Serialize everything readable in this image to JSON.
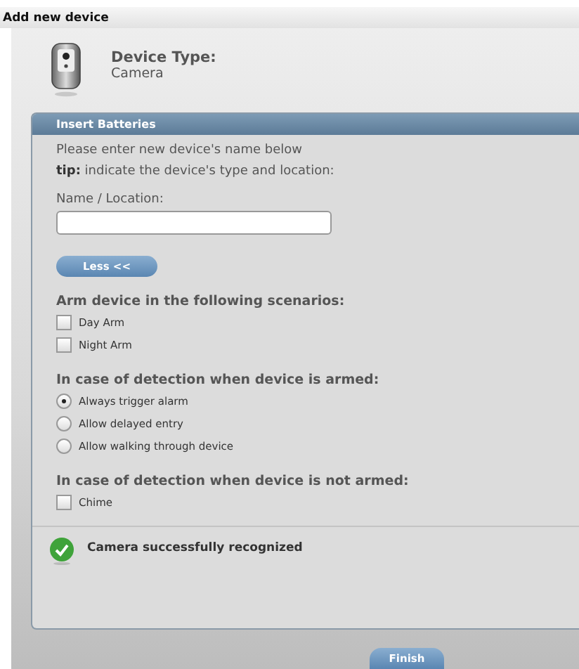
{
  "window": {
    "title": "Add new device"
  },
  "device": {
    "label": "Device Type:",
    "type": "Camera"
  },
  "panel": {
    "title": "Insert Batteries",
    "intro": "Please enter new device's name below",
    "tip": "**tip:** indicate the device's type and location:",
    "name_field": {
      "label": "Name / Location:"
    },
    "less_button": "Less <<",
    "sections": [
      {
        "heading": "Arm device in the following scenarios:",
        "options": [
          {
            "kind": "checkbox",
            "label": "Day Arm",
            "checked": false
          },
          {
            "kind": "checkbox",
            "label": "Night Arm",
            "checked": false
          }
        ]
      },
      {
        "heading": "In case of detection when device is armed:",
        "options": [
          {
            "kind": "radio",
            "label": "Always trigger alarm",
            "selected": true
          },
          {
            "kind": "radio",
            "label": "Allow delayed entry",
            "selected": false
          },
          {
            "kind": "radio",
            "label": "Allow walking through device",
            "selected": false
          }
        ]
      },
      {
        "heading": "In case of detection when device is not armed:",
        "options": [
          {
            "kind": "checkbox",
            "label": "Chime",
            "checked": false
          }
        ]
      }
    ],
    "status": "Camera successfully recognized"
  },
  "buttons": [
    "Finish"
  ]
}
